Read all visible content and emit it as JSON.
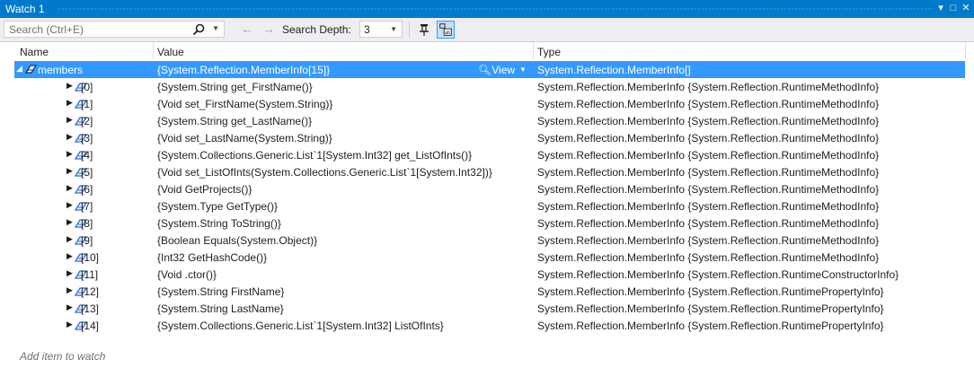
{
  "window": {
    "title": "Watch 1",
    "dropdown_glyph": "▾",
    "restore_glyph": "□",
    "close_glyph": "✕"
  },
  "toolbar": {
    "search_placeholder": "Search (Ctrl+E)",
    "search_depth_label": "Search Depth:",
    "search_depth_value": "3",
    "icons": [
      "search-icon",
      "back-arrow-icon",
      "forward-arrow-icon",
      "pin-icon",
      "hex-view-icon"
    ]
  },
  "columns": {
    "name": "Name",
    "value": "Value",
    "type": "Type"
  },
  "root": {
    "name": "members",
    "value": "{System.Reflection.MemberInfo[15]}",
    "view_label": "View",
    "type": "System.Reflection.MemberInfo[]"
  },
  "rows": [
    {
      "name": "[0]",
      "value": "{System.String get_FirstName()}",
      "type": "System.Reflection.MemberInfo {System.Reflection.RuntimeMethodInfo}"
    },
    {
      "name": "[1]",
      "value": "{Void set_FirstName(System.String)}",
      "type": "System.Reflection.MemberInfo {System.Reflection.RuntimeMethodInfo}"
    },
    {
      "name": "[2]",
      "value": "{System.String get_LastName()}",
      "type": "System.Reflection.MemberInfo {System.Reflection.RuntimeMethodInfo}"
    },
    {
      "name": "[3]",
      "value": "{Void set_LastName(System.String)}",
      "type": "System.Reflection.MemberInfo {System.Reflection.RuntimeMethodInfo}"
    },
    {
      "name": "[4]",
      "value": "{System.Collections.Generic.List`1[System.Int32] get_ListOfInts()}",
      "type": "System.Reflection.MemberInfo {System.Reflection.RuntimeMethodInfo}"
    },
    {
      "name": "[5]",
      "value": "{Void set_ListOfInts(System.Collections.Generic.List`1[System.Int32])}",
      "type": "System.Reflection.MemberInfo {System.Reflection.RuntimeMethodInfo}"
    },
    {
      "name": "[6]",
      "value": "{Void GetProjects()}",
      "type": "System.Reflection.MemberInfo {System.Reflection.RuntimeMethodInfo}"
    },
    {
      "name": "[7]",
      "value": "{System.Type GetType()}",
      "type": "System.Reflection.MemberInfo {System.Reflection.RuntimeMethodInfo}"
    },
    {
      "name": "[8]",
      "value": "{System.String ToString()}",
      "type": "System.Reflection.MemberInfo {System.Reflection.RuntimeMethodInfo}"
    },
    {
      "name": "[9]",
      "value": "{Boolean Equals(System.Object)}",
      "type": "System.Reflection.MemberInfo {System.Reflection.RuntimeMethodInfo}"
    },
    {
      "name": "[10]",
      "value": "{Int32 GetHashCode()}",
      "type": "System.Reflection.MemberInfo {System.Reflection.RuntimeMethodInfo}"
    },
    {
      "name": "[11]",
      "value": "{Void .ctor()}",
      "type": "System.Reflection.MemberInfo {System.Reflection.RuntimeConstructorInfo}"
    },
    {
      "name": "[12]",
      "value": "{System.String FirstName}",
      "type": "System.Reflection.MemberInfo {System.Reflection.RuntimePropertyInfo}"
    },
    {
      "name": "[13]",
      "value": "{System.String LastName}",
      "type": "System.Reflection.MemberInfo {System.Reflection.RuntimePropertyInfo}"
    },
    {
      "name": "[14]",
      "value": "{System.Collections.Generic.List`1[System.Int32] ListOfInts}",
      "type": "System.Reflection.MemberInfo {System.Reflection.RuntimePropertyInfo}"
    }
  ],
  "add_item_placeholder": "Add item to watch",
  "colors": {
    "accent": "#007acc",
    "selection": "#3399ff",
    "member_icon": "#2f6ed1",
    "toolbar_bg": "#eeeef2"
  }
}
